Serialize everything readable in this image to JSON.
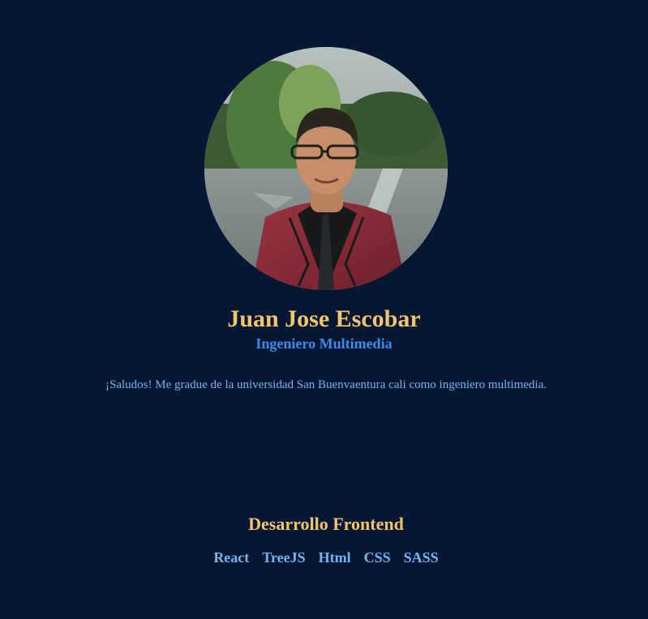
{
  "profile": {
    "name": "Juan Jose Escobar",
    "role": "Ingeniero Multimedia",
    "bio": "¡Saludos! Me gradue de la universidad San Buenvaentura cali como ingeniero multimedia."
  },
  "skills_section": {
    "title": "Desarrollo Frontend",
    "items": [
      "React",
      "TreeJS",
      "Html",
      "CSS",
      "SASS"
    ]
  },
  "colors": {
    "background": "#051733",
    "name": "#f2c46d",
    "role": "#3d8df0",
    "text": "#72b4f4"
  }
}
